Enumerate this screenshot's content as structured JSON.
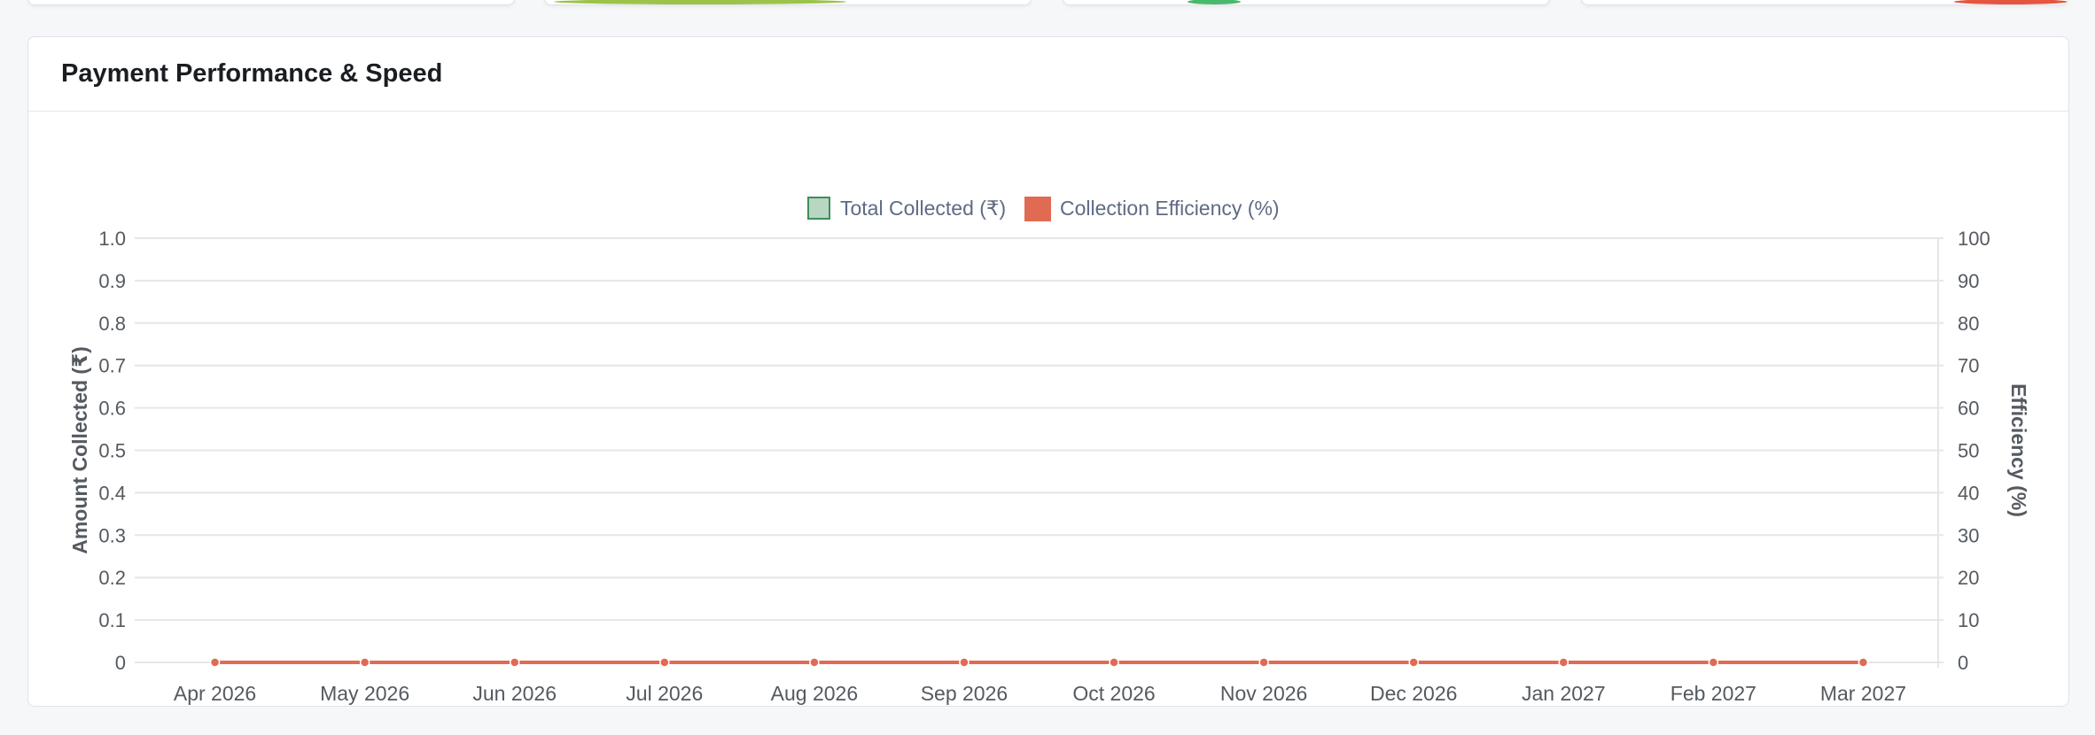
{
  "panel": {
    "title": "Payment Performance & Speed"
  },
  "colors": {
    "collected_fill": "#b9d6c3",
    "collected_stroke": "#3f8d5a",
    "efficiency": "#e06a52",
    "grid": "#e4e6ea",
    "tick_text": "#555a60",
    "legend_text": "#5f6b85"
  },
  "chart_data": {
    "type": "bar",
    "categories": [
      "Apr 2026",
      "May 2026",
      "Jun 2026",
      "Jul 2026",
      "Aug 2026",
      "Sep 2026",
      "Oct 2026",
      "Nov 2026",
      "Dec 2026",
      "Jan 2027",
      "Feb 2027",
      "Mar 2027"
    ],
    "series": [
      {
        "name": "Total Collected (₹)",
        "type": "bar",
        "axis": "left",
        "values": [
          0,
          0,
          0,
          0,
          0,
          0,
          0,
          0,
          0,
          0,
          0,
          0
        ]
      },
      {
        "name": "Collection Efficiency (%)",
        "type": "line",
        "axis": "right",
        "values": [
          0,
          0,
          0,
          0,
          0,
          0,
          0,
          0,
          0,
          0,
          0,
          0
        ]
      }
    ],
    "y_left": {
      "label": "Amount Collected (₹)",
      "range": [
        0,
        1.0
      ],
      "ticks": [
        "0",
        "0.1",
        "0.2",
        "0.3",
        "0.4",
        "0.5",
        "0.6",
        "0.7",
        "0.8",
        "0.9",
        "1.0"
      ]
    },
    "y_right": {
      "label": "Efficiency (%)",
      "range": [
        0,
        100
      ],
      "ticks": [
        "0",
        "10",
        "20",
        "30",
        "40",
        "50",
        "60",
        "70",
        "80",
        "90",
        "100"
      ]
    },
    "legend_position": "top-center",
    "grid": true
  }
}
